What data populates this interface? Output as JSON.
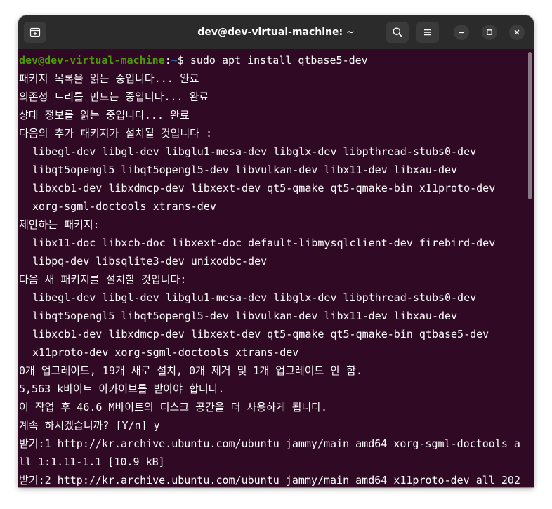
{
  "window": {
    "title": "dev@dev-virtual-machine: ~"
  },
  "prompt": {
    "user_host": "dev@dev-virtual-machine",
    "sep": ":",
    "path": "~",
    "symbol": "$ ",
    "command": "sudo apt install qtbase5-dev"
  },
  "output": [
    {
      "text": "패키지 목록을 읽는 중입니다... 완료",
      "indent": false
    },
    {
      "text": "의존성 트리를 만드는 중입니다... 완료",
      "indent": false
    },
    {
      "text": "상태 정보를 읽는 중입니다... 완료",
      "indent": false
    },
    {
      "text": "다음의 추가 패키지가 설치될 것입니다 :",
      "indent": false
    },
    {
      "text": "libegl-dev libgl-dev libglu1-mesa-dev libglx-dev libpthread-stubs0-dev",
      "indent": true
    },
    {
      "text": "libqt5opengl5 libqt5opengl5-dev libvulkan-dev libx11-dev libxau-dev",
      "indent": true
    },
    {
      "text": "libxcb1-dev libxdmcp-dev libxext-dev qt5-qmake qt5-qmake-bin x11proto-dev",
      "indent": true
    },
    {
      "text": "xorg-sgml-doctools xtrans-dev",
      "indent": true
    },
    {
      "text": "제안하는 패키지:",
      "indent": false
    },
    {
      "text": "libx11-doc libxcb-doc libxext-doc default-libmysqlclient-dev firebird-dev",
      "indent": true
    },
    {
      "text": "libpq-dev libsqlite3-dev unixodbc-dev",
      "indent": true
    },
    {
      "text": "다음 새 패키지를 설치할 것입니다:",
      "indent": false
    },
    {
      "text": "libegl-dev libgl-dev libglu1-mesa-dev libglx-dev libpthread-stubs0-dev",
      "indent": true
    },
    {
      "text": "libqt5opengl5 libqt5opengl5-dev libvulkan-dev libx11-dev libxau-dev",
      "indent": true
    },
    {
      "text": "libxcb1-dev libxdmcp-dev libxext-dev qt5-qmake qt5-qmake-bin qtbase5-dev",
      "indent": true
    },
    {
      "text": "x11proto-dev xorg-sgml-doctools xtrans-dev",
      "indent": true
    },
    {
      "text": "0개 업그레이드, 19개 새로 설치, 0개 제거 및 1개 업그레이드 안 함.",
      "indent": false
    },
    {
      "text": "5,563 k바이트 아카이브를 받아야 합니다.",
      "indent": false
    },
    {
      "text": "이 작업 후 46.6 M바이트의 디스크 공간을 더 사용하게 됩니다.",
      "indent": false
    },
    {
      "text": "계속 하시겠습니까? [Y/n] y",
      "indent": false
    },
    {
      "text": "받기:1 http://kr.archive.ubuntu.com/ubuntu jammy/main amd64 xorg-sgml-doctools a",
      "indent": false
    },
    {
      "text": "ll 1:1.11-1.1 [10.9 kB]",
      "indent": false
    },
    {
      "text": "받기:2 http://kr.archive.ubuntu.com/ubuntu jammy/main amd64 x11proto-dev all 202",
      "indent": false
    }
  ],
  "colors": {
    "terminal_bg": "#300a24",
    "titlebar_bg": "#2b2b2b",
    "prompt_user": "#4e9a06",
    "prompt_path": "#3465a4",
    "text": "#ffffff"
  },
  "icons": {
    "new_tab": "new-tab-icon",
    "search": "search-icon",
    "menu": "hamburger-menu-icon",
    "minimize": "minimize-icon",
    "maximize": "maximize-icon",
    "close": "close-icon"
  }
}
